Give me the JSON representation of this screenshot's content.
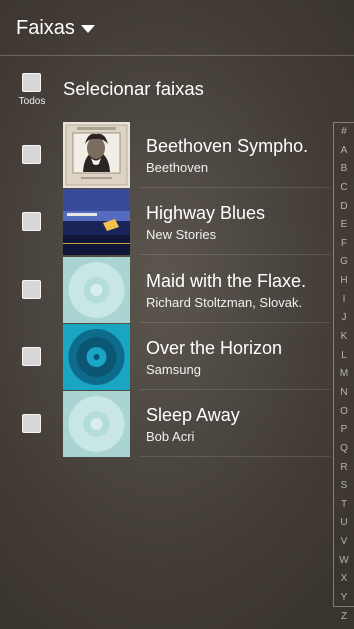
{
  "header": {
    "title": "Faixas",
    "caret_icon": "caret-down-icon"
  },
  "select_all": {
    "label": "Selecionar faixas",
    "todos": "Todos"
  },
  "tracks": [
    {
      "title": "Beethoven Sympho.",
      "artist": "Beethoven",
      "art": "beethoven-portrait"
    },
    {
      "title": "Highway Blues",
      "artist": "New Stories",
      "art": "highway-blues-cover"
    },
    {
      "title": "Maid with the Flaxe.",
      "artist": "Richard Stoltzman, Slovak.",
      "art": "default-disc"
    },
    {
      "title": "Over the Horizon",
      "artist": "Samsung",
      "art": "blue-disc"
    },
    {
      "title": "Sleep Away",
      "artist": "Bob Acri",
      "art": "default-disc"
    }
  ],
  "index_letters": [
    "#",
    "A",
    "B",
    "C",
    "D",
    "E",
    "F",
    "G",
    "H",
    "I",
    "J",
    "K",
    "L",
    "M",
    "N",
    "O",
    "P",
    "Q",
    "R",
    "S",
    "T",
    "U",
    "V",
    "W",
    "X",
    "Y",
    "Z"
  ]
}
